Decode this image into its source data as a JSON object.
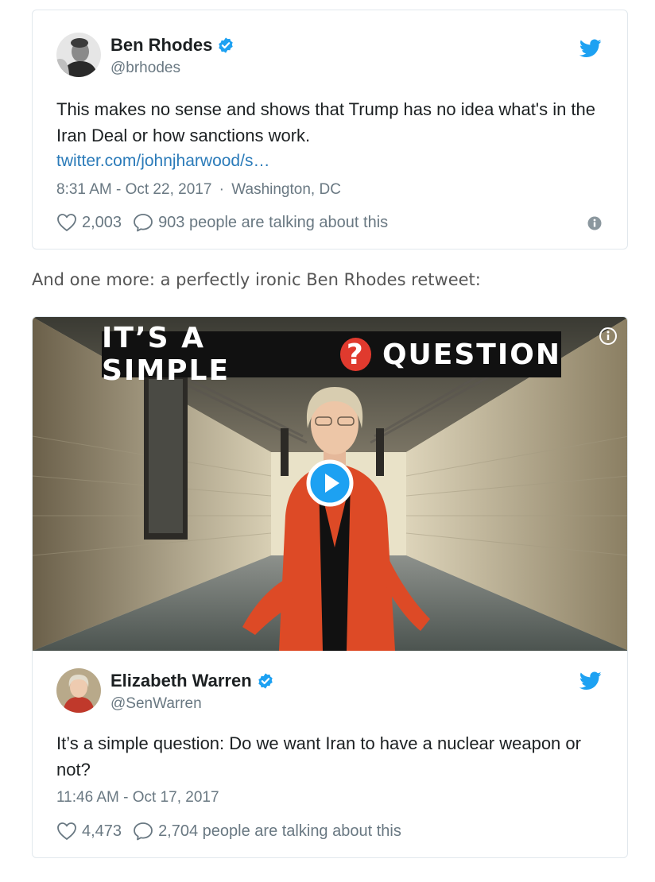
{
  "tweets": [
    {
      "author_name": "Ben Rhodes",
      "handle": "@brhodes",
      "text": "This makes no sense and shows that Trump has no idea what's in the Iran Deal or how sanctions work.",
      "link": "twitter.com/johnjharwood/s…",
      "timestamp": "8:31 AM - Oct 22, 2017",
      "location": "Washington, DC",
      "meta_separator": "·",
      "likes": "2,003",
      "talking": "903 people are talking about this"
    },
    {
      "author_name": "Elizabeth Warren",
      "handle": "@SenWarren",
      "text": "It’s a simple question: Do we want Iran to have a nuclear weapon or not?",
      "timestamp": "11:46 AM - Oct 17, 2017",
      "likes": "4,473",
      "talking": "2,704 people are talking about this",
      "video_banner_left": "IT’S A SIMPLE",
      "video_banner_mark": "?",
      "video_banner_right": "QUESTION"
    }
  ],
  "intro_text": "And one more: a perfectly ironic Ben Rhodes retweet:",
  "icons": {
    "verified": "verified-badge-icon",
    "twitter_bird": "twitter-bird-icon",
    "like": "heart-icon",
    "reply": "speech-bubble-icon",
    "info": "info-icon",
    "play": "play-icon"
  },
  "colors": {
    "brand_blue": "#1da1f2",
    "link_blue": "#2b7bb9",
    "meta_gray": "#697882",
    "banner_red": "#e03a2e"
  }
}
